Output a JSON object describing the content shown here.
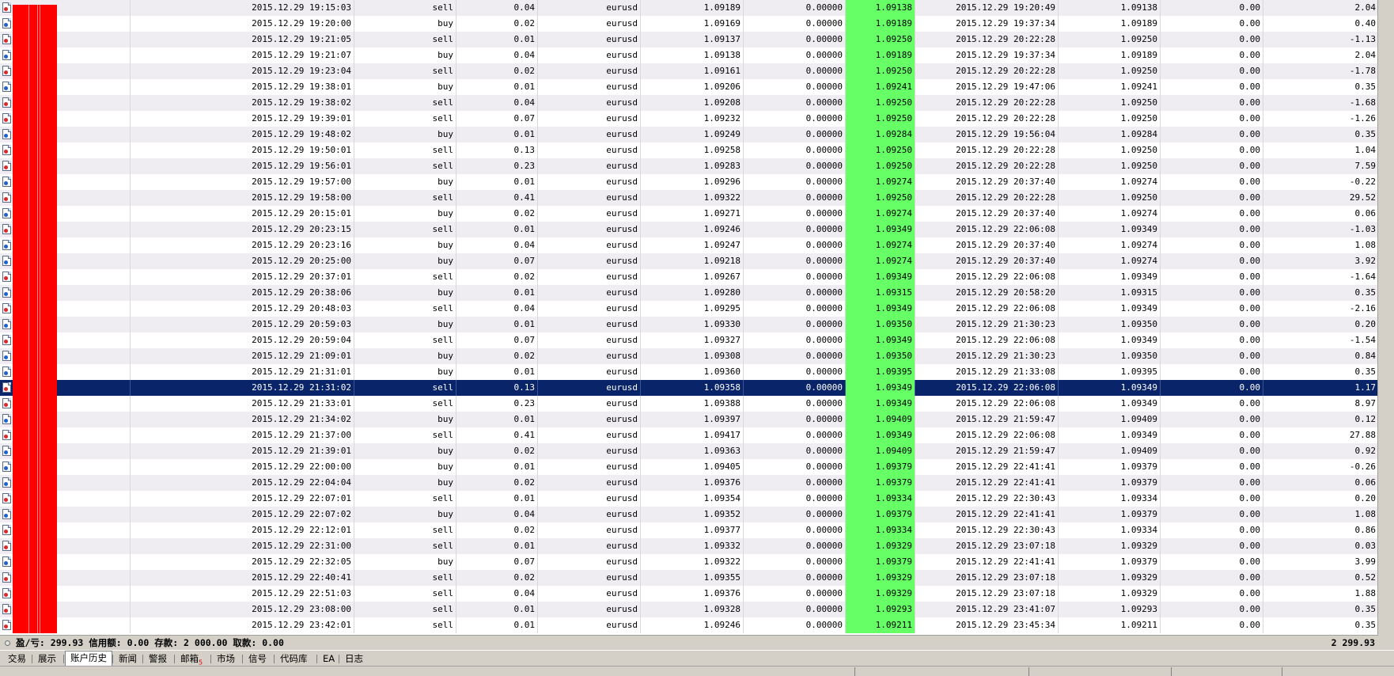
{
  "summary": {
    "text": "盈/亏: 299.93  信用额: 0.00  存款: 2 000.00  取款: 0.00",
    "total": "2 299.93"
  },
  "tabs": [
    {
      "label": "交易",
      "badge": ""
    },
    {
      "label": "展示",
      "badge": ""
    },
    {
      "label": "账户历史",
      "badge": ""
    },
    {
      "label": "新闻",
      "badge": ""
    },
    {
      "label": "警报",
      "badge": ""
    },
    {
      "label": "邮箱",
      "badge": "5"
    },
    {
      "label": "市场",
      "badge": ""
    },
    {
      "label": "信号",
      "badge": ""
    },
    {
      "label": "代码库",
      "badge": ""
    },
    {
      "label": "EA",
      "badge": ""
    },
    {
      "label": "日志",
      "badge": ""
    }
  ],
  "active_tab": "账户历史",
  "colors": {
    "selected_row": "#0a246a",
    "tp_highlight": "#66ff66",
    "redaction": "#ff0000"
  },
  "rows": [
    {
      "time": "2015.12.29 19:15:03",
      "type": "sell",
      "size": "0.04",
      "symbol": "eurusd",
      "open": "1.09189",
      "sl": "0.00000",
      "tp": "1.09138",
      "ctime": "2015.12.29 19:20:49",
      "cprice": "1.09138",
      "swap": "0.00",
      "profit": "2.04"
    },
    {
      "time": "2015.12.29 19:20:00",
      "type": "buy",
      "size": "0.02",
      "symbol": "eurusd",
      "open": "1.09169",
      "sl": "0.00000",
      "tp": "1.09189",
      "ctime": "2015.12.29 19:37:34",
      "cprice": "1.09189",
      "swap": "0.00",
      "profit": "0.40"
    },
    {
      "time": "2015.12.29 19:21:05",
      "type": "sell",
      "size": "0.01",
      "symbol": "eurusd",
      "open": "1.09137",
      "sl": "0.00000",
      "tp": "1.09250",
      "ctime": "2015.12.29 20:22:28",
      "cprice": "1.09250",
      "swap": "0.00",
      "profit": "-1.13"
    },
    {
      "time": "2015.12.29 19:21:07",
      "type": "buy",
      "size": "0.04",
      "symbol": "eurusd",
      "open": "1.09138",
      "sl": "0.00000",
      "tp": "1.09189",
      "ctime": "2015.12.29 19:37:34",
      "cprice": "1.09189",
      "swap": "0.00",
      "profit": "2.04"
    },
    {
      "time": "2015.12.29 19:23:04",
      "type": "sell",
      "size": "0.02",
      "symbol": "eurusd",
      "open": "1.09161",
      "sl": "0.00000",
      "tp": "1.09250",
      "ctime": "2015.12.29 20:22:28",
      "cprice": "1.09250",
      "swap": "0.00",
      "profit": "-1.78"
    },
    {
      "time": "2015.12.29 19:38:01",
      "type": "buy",
      "size": "0.01",
      "symbol": "eurusd",
      "open": "1.09206",
      "sl": "0.00000",
      "tp": "1.09241",
      "ctime": "2015.12.29 19:47:06",
      "cprice": "1.09241",
      "swap": "0.00",
      "profit": "0.35"
    },
    {
      "time": "2015.12.29 19:38:02",
      "type": "sell",
      "size": "0.04",
      "symbol": "eurusd",
      "open": "1.09208",
      "sl": "0.00000",
      "tp": "1.09250",
      "ctime": "2015.12.29 20:22:28",
      "cprice": "1.09250",
      "swap": "0.00",
      "profit": "-1.68"
    },
    {
      "time": "2015.12.29 19:39:01",
      "type": "sell",
      "size": "0.07",
      "symbol": "eurusd",
      "open": "1.09232",
      "sl": "0.00000",
      "tp": "1.09250",
      "ctime": "2015.12.29 20:22:28",
      "cprice": "1.09250",
      "swap": "0.00",
      "profit": "-1.26"
    },
    {
      "time": "2015.12.29 19:48:02",
      "type": "buy",
      "size": "0.01",
      "symbol": "eurusd",
      "open": "1.09249",
      "sl": "0.00000",
      "tp": "1.09284",
      "ctime": "2015.12.29 19:56:04",
      "cprice": "1.09284",
      "swap": "0.00",
      "profit": "0.35"
    },
    {
      "time": "2015.12.29 19:50:01",
      "type": "sell",
      "size": "0.13",
      "symbol": "eurusd",
      "open": "1.09258",
      "sl": "0.00000",
      "tp": "1.09250",
      "ctime": "2015.12.29 20:22:28",
      "cprice": "1.09250",
      "swap": "0.00",
      "profit": "1.04"
    },
    {
      "time": "2015.12.29 19:56:01",
      "type": "sell",
      "size": "0.23",
      "symbol": "eurusd",
      "open": "1.09283",
      "sl": "0.00000",
      "tp": "1.09250",
      "ctime": "2015.12.29 20:22:28",
      "cprice": "1.09250",
      "swap": "0.00",
      "profit": "7.59"
    },
    {
      "time": "2015.12.29 19:57:00",
      "type": "buy",
      "size": "0.01",
      "symbol": "eurusd",
      "open": "1.09296",
      "sl": "0.00000",
      "tp": "1.09274",
      "ctime": "2015.12.29 20:37:40",
      "cprice": "1.09274",
      "swap": "0.00",
      "profit": "-0.22"
    },
    {
      "time": "2015.12.29 19:58:00",
      "type": "sell",
      "size": "0.41",
      "symbol": "eurusd",
      "open": "1.09322",
      "sl": "0.00000",
      "tp": "1.09250",
      "ctime": "2015.12.29 20:22:28",
      "cprice": "1.09250",
      "swap": "0.00",
      "profit": "29.52"
    },
    {
      "time": "2015.12.29 20:15:01",
      "type": "buy",
      "size": "0.02",
      "symbol": "eurusd",
      "open": "1.09271",
      "sl": "0.00000",
      "tp": "1.09274",
      "ctime": "2015.12.29 20:37:40",
      "cprice": "1.09274",
      "swap": "0.00",
      "profit": "0.06"
    },
    {
      "time": "2015.12.29 20:23:15",
      "type": "sell",
      "size": "0.01",
      "symbol": "eurusd",
      "open": "1.09246",
      "sl": "0.00000",
      "tp": "1.09349",
      "ctime": "2015.12.29 22:06:08",
      "cprice": "1.09349",
      "swap": "0.00",
      "profit": "-1.03"
    },
    {
      "time": "2015.12.29 20:23:16",
      "type": "buy",
      "size": "0.04",
      "symbol": "eurusd",
      "open": "1.09247",
      "sl": "0.00000",
      "tp": "1.09274",
      "ctime": "2015.12.29 20:37:40",
      "cprice": "1.09274",
      "swap": "0.00",
      "profit": "1.08"
    },
    {
      "time": "2015.12.29 20:25:00",
      "type": "buy",
      "size": "0.07",
      "symbol": "eurusd",
      "open": "1.09218",
      "sl": "0.00000",
      "tp": "1.09274",
      "ctime": "2015.12.29 20:37:40",
      "cprice": "1.09274",
      "swap": "0.00",
      "profit": "3.92"
    },
    {
      "time": "2015.12.29 20:37:01",
      "type": "sell",
      "size": "0.02",
      "symbol": "eurusd",
      "open": "1.09267",
      "sl": "0.00000",
      "tp": "1.09349",
      "ctime": "2015.12.29 22:06:08",
      "cprice": "1.09349",
      "swap": "0.00",
      "profit": "-1.64"
    },
    {
      "time": "2015.12.29 20:38:06",
      "type": "buy",
      "size": "0.01",
      "symbol": "eurusd",
      "open": "1.09280",
      "sl": "0.00000",
      "tp": "1.09315",
      "ctime": "2015.12.29 20:58:20",
      "cprice": "1.09315",
      "swap": "0.00",
      "profit": "0.35"
    },
    {
      "time": "2015.12.29 20:48:03",
      "type": "sell",
      "size": "0.04",
      "symbol": "eurusd",
      "open": "1.09295",
      "sl": "0.00000",
      "tp": "1.09349",
      "ctime": "2015.12.29 22:06:08",
      "cprice": "1.09349",
      "swap": "0.00",
      "profit": "-2.16"
    },
    {
      "time": "2015.12.29 20:59:03",
      "type": "buy",
      "size": "0.01",
      "symbol": "eurusd",
      "open": "1.09330",
      "sl": "0.00000",
      "tp": "1.09350",
      "ctime": "2015.12.29 21:30:23",
      "cprice": "1.09350",
      "swap": "0.00",
      "profit": "0.20"
    },
    {
      "time": "2015.12.29 20:59:04",
      "type": "sell",
      "size": "0.07",
      "symbol": "eurusd",
      "open": "1.09327",
      "sl": "0.00000",
      "tp": "1.09349",
      "ctime": "2015.12.29 22:06:08",
      "cprice": "1.09349",
      "swap": "0.00",
      "profit": "-1.54"
    },
    {
      "time": "2015.12.29 21:09:01",
      "type": "buy",
      "size": "0.02",
      "symbol": "eurusd",
      "open": "1.09308",
      "sl": "0.00000",
      "tp": "1.09350",
      "ctime": "2015.12.29 21:30:23",
      "cprice": "1.09350",
      "swap": "0.00",
      "profit": "0.84"
    },
    {
      "time": "2015.12.29 21:31:01",
      "type": "buy",
      "size": "0.01",
      "symbol": "eurusd",
      "open": "1.09360",
      "sl": "0.00000",
      "tp": "1.09395",
      "ctime": "2015.12.29 21:33:08",
      "cprice": "1.09395",
      "swap": "0.00",
      "profit": "0.35"
    },
    {
      "time": "2015.12.29 21:31:02",
      "type": "sell",
      "size": "0.13",
      "symbol": "eurusd",
      "open": "1.09358",
      "sl": "0.00000",
      "tp": "1.09349",
      "ctime": "2015.12.29 22:06:08",
      "cprice": "1.09349",
      "swap": "0.00",
      "profit": "1.17",
      "selected": true
    },
    {
      "time": "2015.12.29 21:33:01",
      "type": "sell",
      "size": "0.23",
      "symbol": "eurusd",
      "open": "1.09388",
      "sl": "0.00000",
      "tp": "1.09349",
      "ctime": "2015.12.29 22:06:08",
      "cprice": "1.09349",
      "swap": "0.00",
      "profit": "8.97"
    },
    {
      "time": "2015.12.29 21:34:02",
      "type": "buy",
      "size": "0.01",
      "symbol": "eurusd",
      "open": "1.09397",
      "sl": "0.00000",
      "tp": "1.09409",
      "ctime": "2015.12.29 21:59:47",
      "cprice": "1.09409",
      "swap": "0.00",
      "profit": "0.12"
    },
    {
      "time": "2015.12.29 21:37:00",
      "type": "sell",
      "size": "0.41",
      "symbol": "eurusd",
      "open": "1.09417",
      "sl": "0.00000",
      "tp": "1.09349",
      "ctime": "2015.12.29 22:06:08",
      "cprice": "1.09349",
      "swap": "0.00",
      "profit": "27.88"
    },
    {
      "time": "2015.12.29 21:39:01",
      "type": "buy",
      "size": "0.02",
      "symbol": "eurusd",
      "open": "1.09363",
      "sl": "0.00000",
      "tp": "1.09409",
      "ctime": "2015.12.29 21:59:47",
      "cprice": "1.09409",
      "swap": "0.00",
      "profit": "0.92"
    },
    {
      "time": "2015.12.29 22:00:00",
      "type": "buy",
      "size": "0.01",
      "symbol": "eurusd",
      "open": "1.09405",
      "sl": "0.00000",
      "tp": "1.09379",
      "ctime": "2015.12.29 22:41:41",
      "cprice": "1.09379",
      "swap": "0.00",
      "profit": "-0.26"
    },
    {
      "time": "2015.12.29 22:04:04",
      "type": "buy",
      "size": "0.02",
      "symbol": "eurusd",
      "open": "1.09376",
      "sl": "0.00000",
      "tp": "1.09379",
      "ctime": "2015.12.29 22:41:41",
      "cprice": "1.09379",
      "swap": "0.00",
      "profit": "0.06"
    },
    {
      "time": "2015.12.29 22:07:01",
      "type": "sell",
      "size": "0.01",
      "symbol": "eurusd",
      "open": "1.09354",
      "sl": "0.00000",
      "tp": "1.09334",
      "ctime": "2015.12.29 22:30:43",
      "cprice": "1.09334",
      "swap": "0.00",
      "profit": "0.20"
    },
    {
      "time": "2015.12.29 22:07:02",
      "type": "buy",
      "size": "0.04",
      "symbol": "eurusd",
      "open": "1.09352",
      "sl": "0.00000",
      "tp": "1.09379",
      "ctime": "2015.12.29 22:41:41",
      "cprice": "1.09379",
      "swap": "0.00",
      "profit": "1.08"
    },
    {
      "time": "2015.12.29 22:12:01",
      "type": "sell",
      "size": "0.02",
      "symbol": "eurusd",
      "open": "1.09377",
      "sl": "0.00000",
      "tp": "1.09334",
      "ctime": "2015.12.29 22:30:43",
      "cprice": "1.09334",
      "swap": "0.00",
      "profit": "0.86"
    },
    {
      "time": "2015.12.29 22:31:00",
      "type": "sell",
      "size": "0.01",
      "symbol": "eurusd",
      "open": "1.09332",
      "sl": "0.00000",
      "tp": "1.09329",
      "ctime": "2015.12.29 23:07:18",
      "cprice": "1.09329",
      "swap": "0.00",
      "profit": "0.03"
    },
    {
      "time": "2015.12.29 22:32:05",
      "type": "buy",
      "size": "0.07",
      "symbol": "eurusd",
      "open": "1.09322",
      "sl": "0.00000",
      "tp": "1.09379",
      "ctime": "2015.12.29 22:41:41",
      "cprice": "1.09379",
      "swap": "0.00",
      "profit": "3.99"
    },
    {
      "time": "2015.12.29 22:40:41",
      "type": "sell",
      "size": "0.02",
      "symbol": "eurusd",
      "open": "1.09355",
      "sl": "0.00000",
      "tp": "1.09329",
      "ctime": "2015.12.29 23:07:18",
      "cprice": "1.09329",
      "swap": "0.00",
      "profit": "0.52"
    },
    {
      "time": "2015.12.29 22:51:03",
      "type": "sell",
      "size": "0.04",
      "symbol": "eurusd",
      "open": "1.09376",
      "sl": "0.00000",
      "tp": "1.09329",
      "ctime": "2015.12.29 23:07:18",
      "cprice": "1.09329",
      "swap": "0.00",
      "profit": "1.88"
    },
    {
      "time": "2015.12.29 23:08:00",
      "type": "sell",
      "size": "0.01",
      "symbol": "eurusd",
      "open": "1.09328",
      "sl": "0.00000",
      "tp": "1.09293",
      "ctime": "2015.12.29 23:41:07",
      "cprice": "1.09293",
      "swap": "0.00",
      "profit": "0.35"
    },
    {
      "time": "2015.12.29 23:42:01",
      "type": "sell",
      "size": "0.01",
      "symbol": "eurusd",
      "open": "1.09246",
      "sl": "0.00000",
      "tp": "1.09211",
      "ctime": "2015.12.29 23:45:34",
      "cprice": "1.09211",
      "swap": "0.00",
      "profit": "0.35"
    }
  ]
}
